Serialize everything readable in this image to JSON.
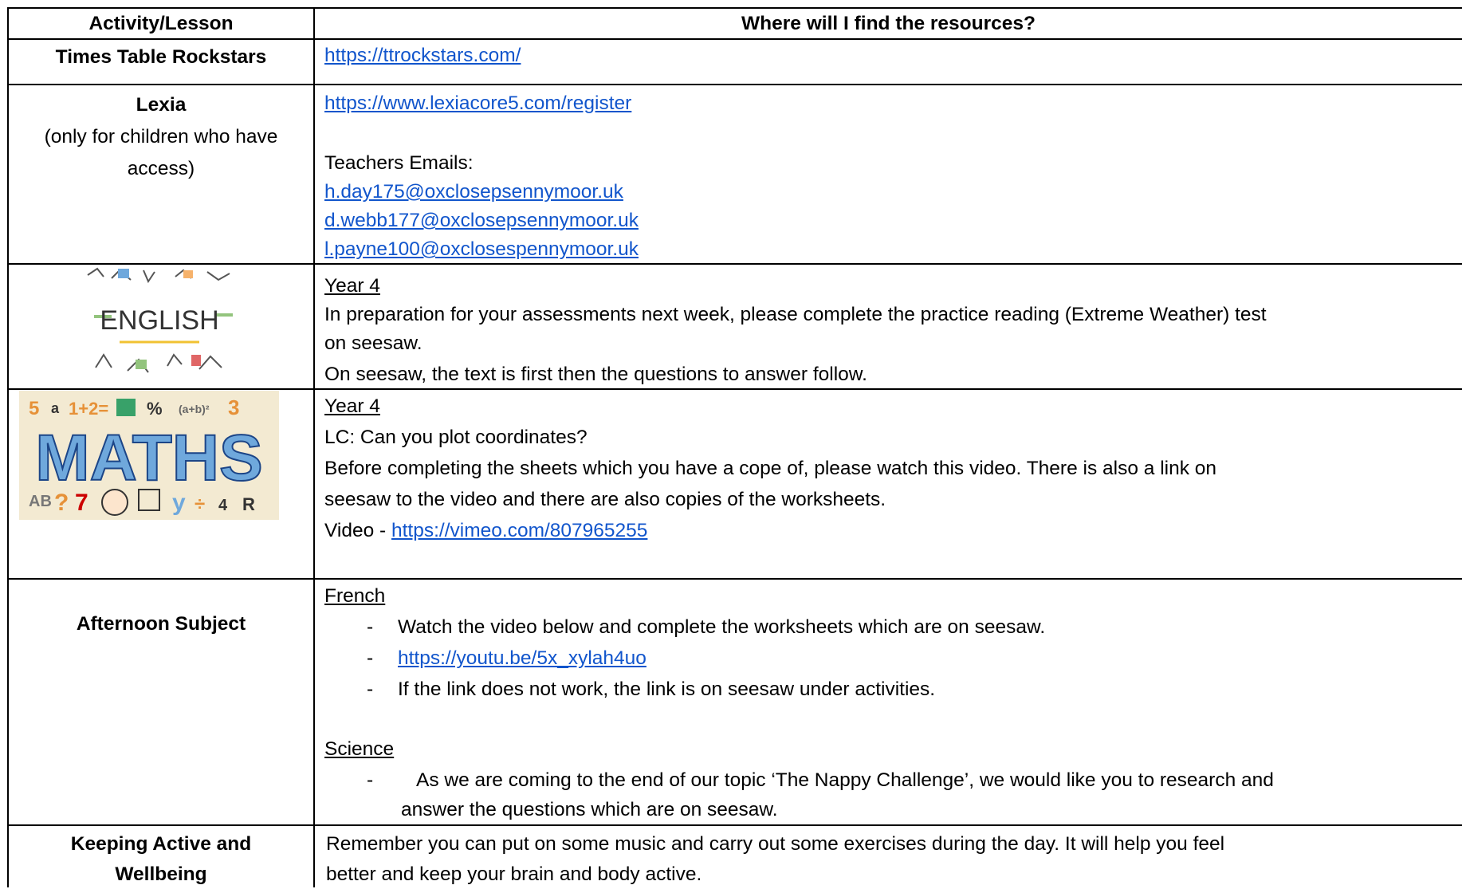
{
  "header": {
    "col1": "Activity/Lesson",
    "col2": "Where will I find the resources?"
  },
  "rows": {
    "ttrs": {
      "label": "Times Table Rockstars",
      "link": "https://ttrockstars.com/"
    },
    "lexia": {
      "label": "Lexia",
      "sub1": "(only for children who have",
      "sub2": "access)",
      "link": "https://www.lexiacore5.com/register",
      "emails_heading": "Teachers Emails:",
      "emails": [
        "h.day175@oxclosepsennymoor.uk",
        "d.webb177@oxclosepsennymoor.uk",
        "l.payne100@oxclosespennymoor.uk"
      ]
    },
    "english": {
      "image_word": "ENGLISH",
      "year": "Year 4",
      "line1": "In preparation for your assessments next week, please complete the practice reading (Extreme Weather) test",
      "line2": "on seesaw.",
      "line3": "On seesaw, the text is first then the questions to answer follow."
    },
    "maths": {
      "image_word": "MATHS",
      "year": "Year 4",
      "lc": "LC: Can you plot coordinates?",
      "line1": "Before completing the sheets which you have a cope of, please watch this video. There is also a link on",
      "line2": "seesaw to the video and there are also copies of the worksheets.",
      "video_prefix": "Video - ",
      "video_link": "https://vimeo.com/807965255"
    },
    "afternoon": {
      "label": "Afternoon Subject",
      "french_heading": "French",
      "french_items": [
        "Watch the video below and complete the worksheets which are on seesaw.",
        "https://youtu.be/5x_xylah4uo",
        "If the link does not work, the link is on seesaw under activities."
      ],
      "science_heading": "Science",
      "science_line1": "As we are coming to the end of our topic ‘The Nappy Challenge’, we would like you to research and",
      "science_line2": "answer the questions which are on seesaw."
    },
    "active": {
      "label1": "Keeping Active and",
      "label2": "Wellbeing",
      "line1": "Remember you can put on some music and carry out some exercises during the day. It will help you feel",
      "line2": "better and keep your brain and body active."
    }
  },
  "icons": [
    "english-illustration",
    "maths-illustration"
  ],
  "colors": {
    "link": "#1155cc",
    "border": "#000000"
  }
}
